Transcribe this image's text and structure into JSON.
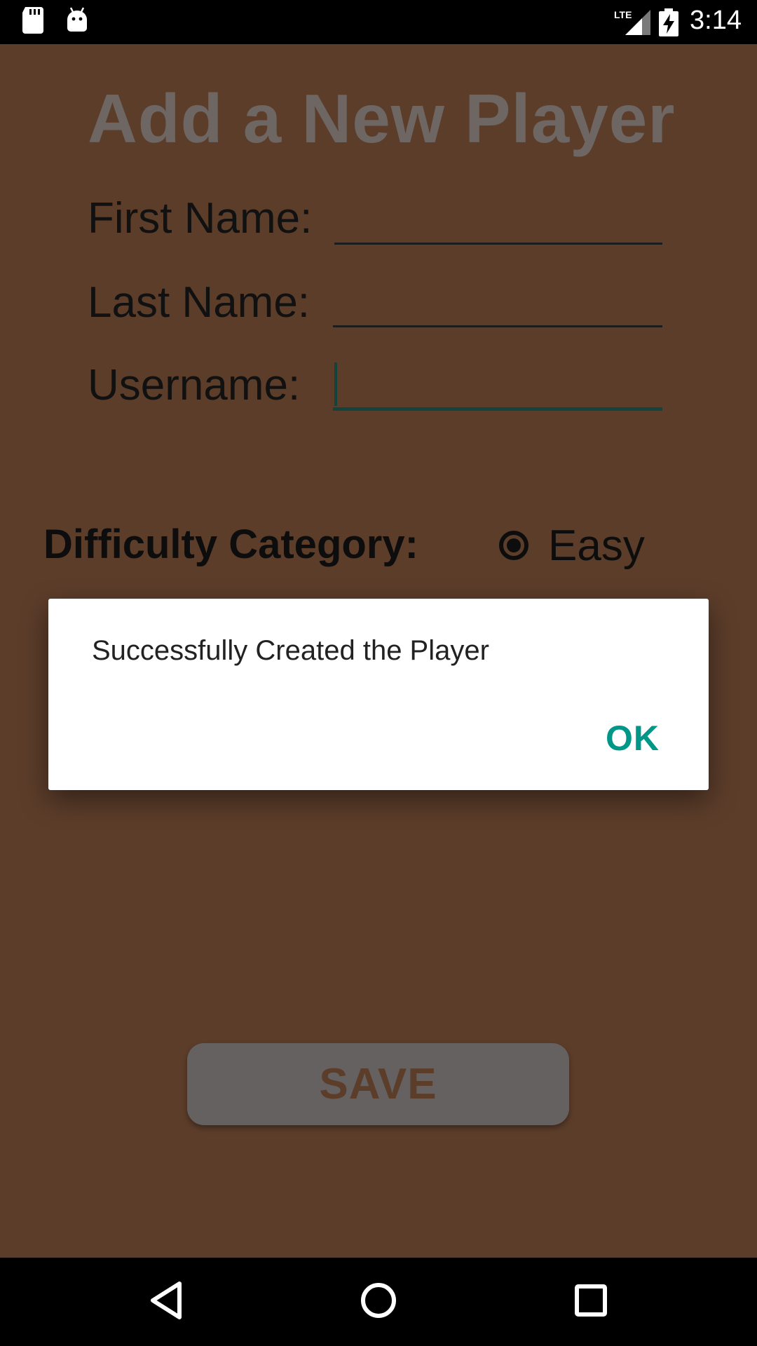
{
  "status_bar": {
    "time": "3:14",
    "network_label": "LTE",
    "icons": [
      "sd-card-icon",
      "android-debug-icon",
      "lte-signal-icon",
      "battery-charging-icon"
    ]
  },
  "screen": {
    "title": "Add a New Player",
    "fields": {
      "first_name_label": "First Name:",
      "last_name_label": "Last Name:",
      "username_label": "Username:",
      "first_name_value": "",
      "last_name_value": "",
      "username_value": ""
    },
    "difficulty": {
      "label": "Difficulty Category:",
      "selected_option": "Easy"
    },
    "save_label": "SAVE"
  },
  "dialog": {
    "message": "Successfully Created the Player",
    "ok_label": "OK"
  },
  "navigation": {
    "icons": [
      "back-icon",
      "home-icon",
      "recents-icon"
    ]
  },
  "colors": {
    "background": "#5c3d2a",
    "title": "#6d6663",
    "accent": "#009688",
    "save_button": "#656161"
  }
}
